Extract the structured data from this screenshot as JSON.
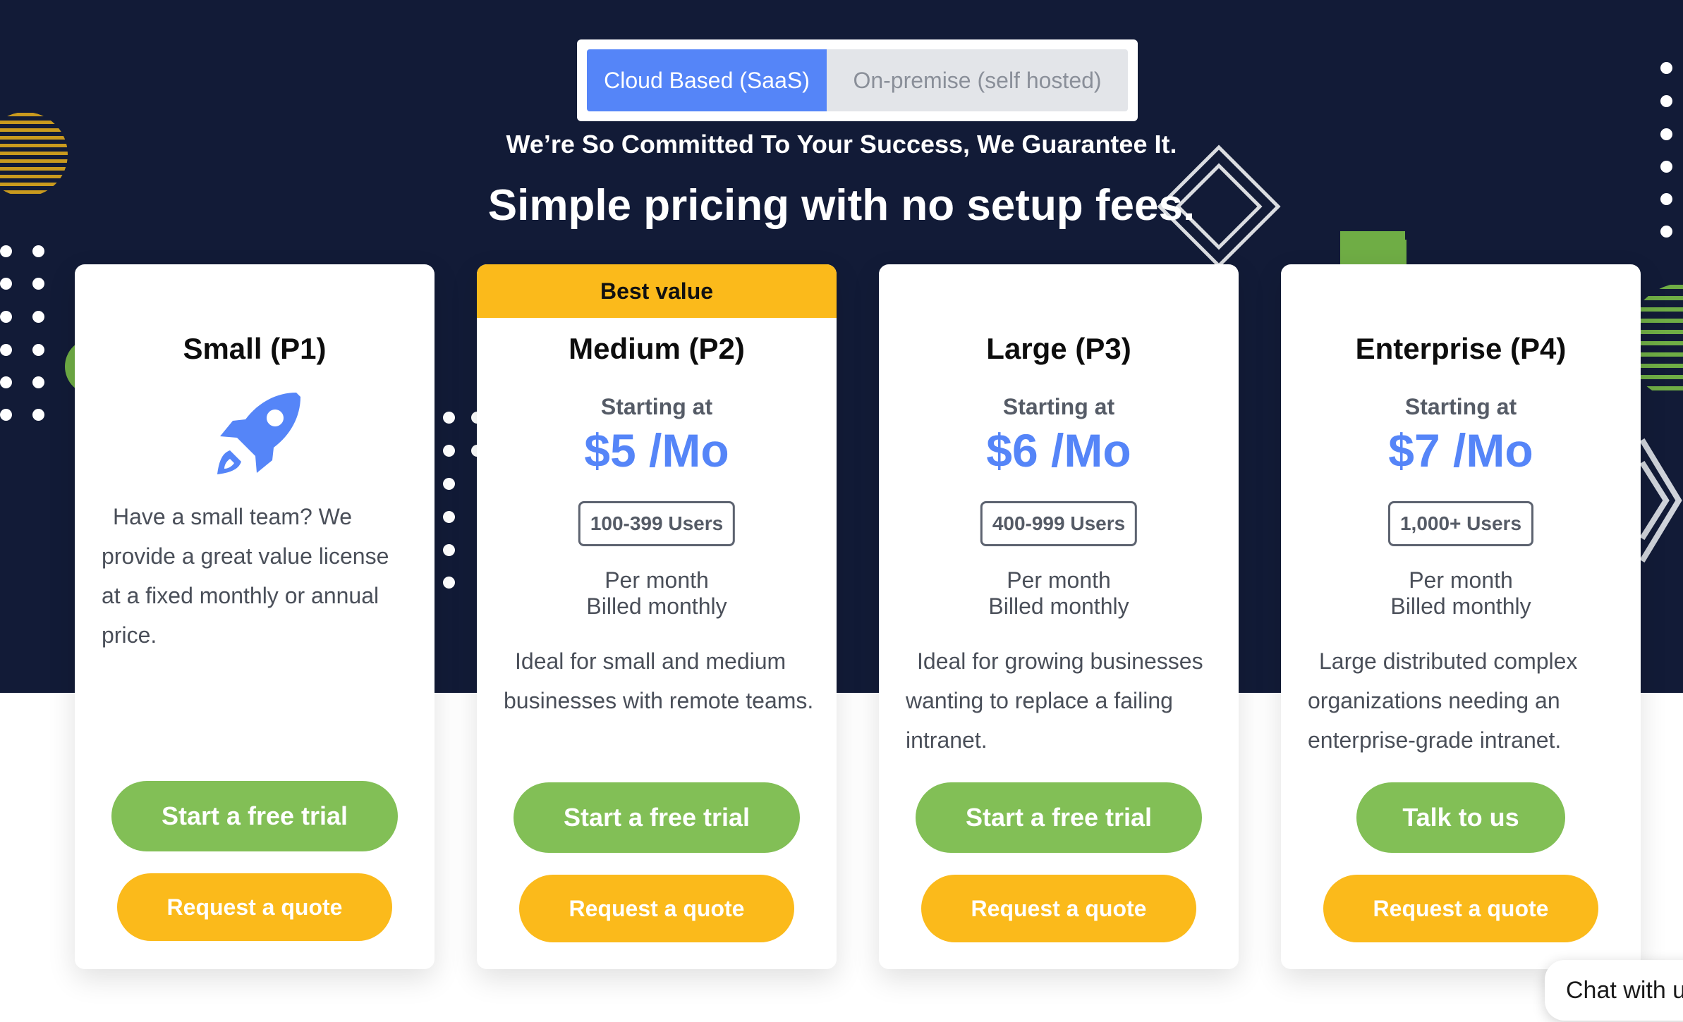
{
  "deployment_toggle": {
    "options": [
      {
        "label": "Cloud Based (SaaS)",
        "selected": true
      },
      {
        "label": "On-premise (self hosted)",
        "selected": false
      }
    ]
  },
  "hero": {
    "tagline": "We’re So Committed To Your Success, We Guarantee It.",
    "headline": "Simple pricing with no setup fees."
  },
  "plans": [
    {
      "name": "Small (P1)",
      "icon": "rocket-icon",
      "description": "Have a small team? We provide a great value license at a fixed monthly or annual price.",
      "primary_cta": "Start a free trial",
      "secondary_cta": "Request a quote"
    },
    {
      "badge": "Best value",
      "name": "Medium (P2)",
      "starting_label": "Starting at",
      "price": "$5 /Mo",
      "users": "100-399 Users",
      "billing_line1": "Per month",
      "billing_line2": "Billed monthly",
      "description": "Ideal for small and medium businesses with remote teams.",
      "primary_cta": "Start a free trial",
      "secondary_cta": "Request a quote"
    },
    {
      "name": "Large (P3)",
      "starting_label": "Starting at",
      "price": "$6 /Mo",
      "users": "400-999 Users",
      "billing_line1": "Per month",
      "billing_line2": "Billed monthly",
      "description": "Ideal for growing businesses wanting to replace a failing intranet.",
      "primary_cta": "Start a free trial",
      "secondary_cta": "Request a quote"
    },
    {
      "name": "Enterprise (P4)",
      "starting_label": "Starting at",
      "price": "$7 /Mo",
      "users": "1,000+ Users",
      "billing_line1": "Per month",
      "billing_line2": "Billed monthly",
      "description": "Large distributed complex organizations needing an enterprise-grade intranet.",
      "primary_cta": "Talk to us",
      "secondary_cta": "Request a quote"
    }
  ],
  "chat_widget": {
    "label": "Chat with us"
  },
  "colors": {
    "hero_background": "#121b37",
    "accent_blue": "#5585f8",
    "cta_green": "#82bf56",
    "cta_yellow": "#fbba1b"
  }
}
